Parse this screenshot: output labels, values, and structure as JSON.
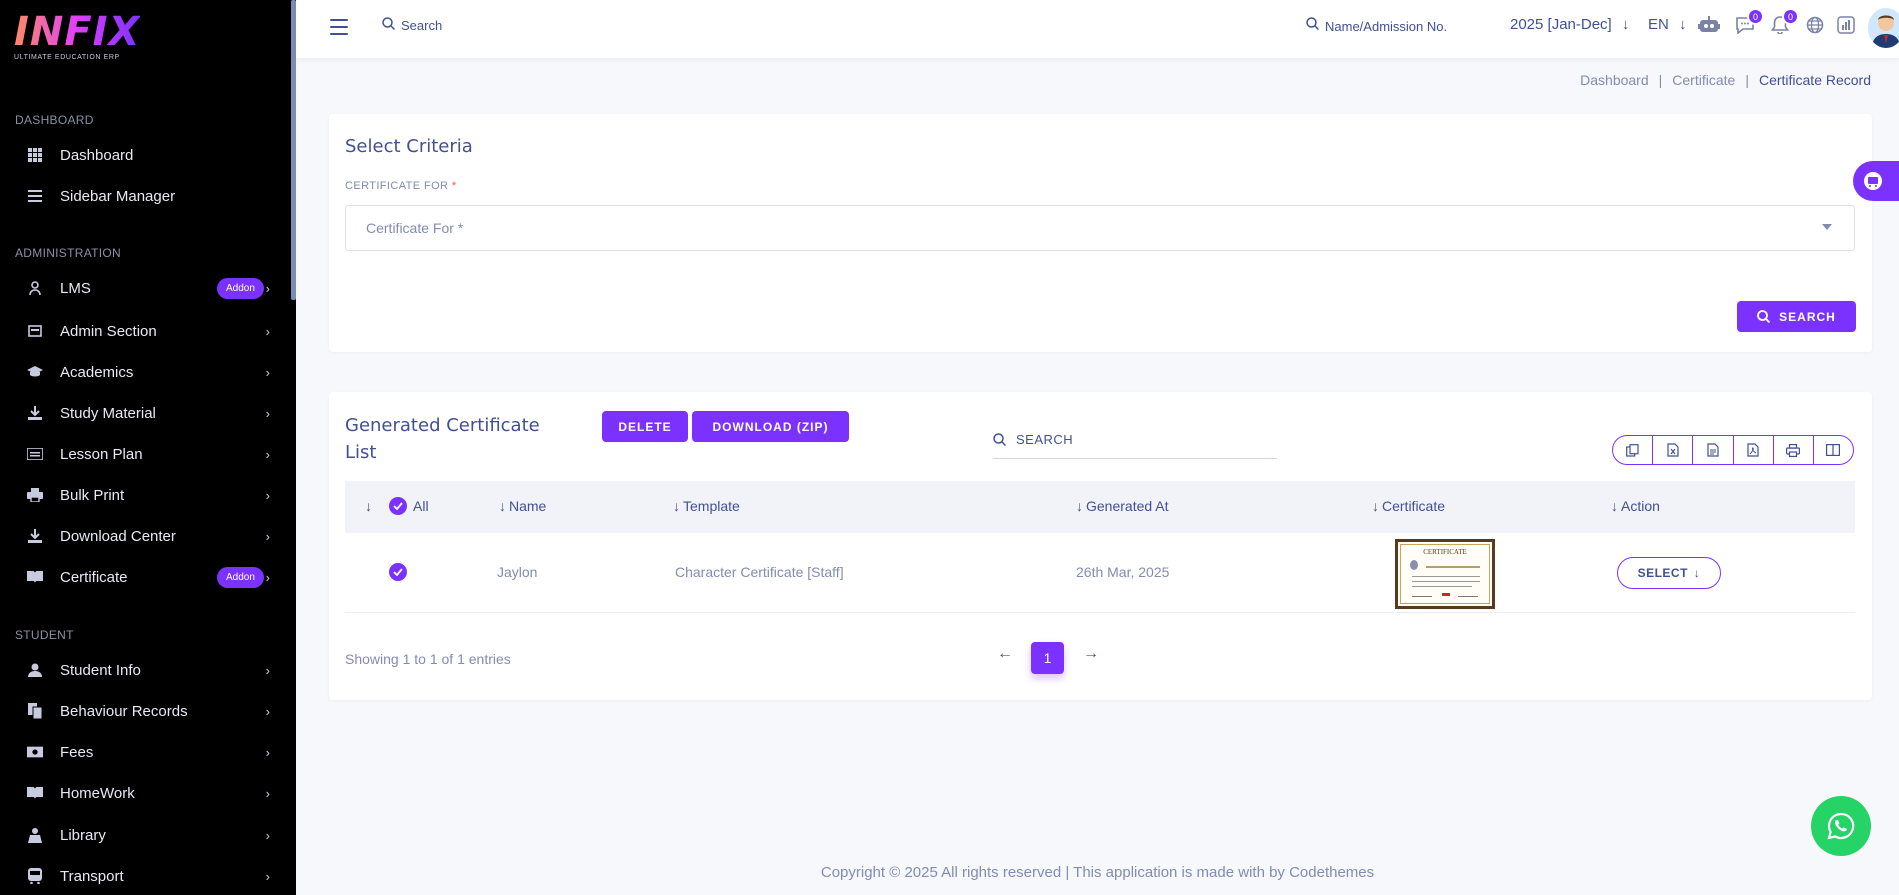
{
  "brand": {
    "logo": "INFIX",
    "tagline": "ULTIMATE EDUCATION ERP"
  },
  "sidebar": {
    "sections": [
      {
        "title": "DASHBOARD",
        "items": [
          {
            "label": "Dashboard",
            "icon": "grid-icon"
          },
          {
            "label": "Sidebar Manager",
            "icon": "list-icon"
          }
        ]
      },
      {
        "title": "ADMINISTRATION",
        "items": [
          {
            "label": "LMS",
            "icon": "user-badge-icon",
            "addon": "Addon"
          },
          {
            "label": "Admin Section",
            "icon": "admin-icon"
          },
          {
            "label": "Academics",
            "icon": "graduation-cap-icon"
          },
          {
            "label": "Study Material",
            "icon": "download-icon"
          },
          {
            "label": "Lesson Plan",
            "icon": "lesson-icon"
          },
          {
            "label": "Bulk Print",
            "icon": "print-icon"
          },
          {
            "label": "Download Center",
            "icon": "download-icon"
          },
          {
            "label": "Certificate",
            "icon": "book-icon",
            "addon": "Addon"
          }
        ]
      },
      {
        "title": "STUDENT",
        "items": [
          {
            "label": "Student Info",
            "icon": "student-icon"
          },
          {
            "label": "Behaviour Records",
            "icon": "records-icon"
          },
          {
            "label": "Fees",
            "icon": "money-icon"
          },
          {
            "label": "HomeWork",
            "icon": "book-icon"
          },
          {
            "label": "Library",
            "icon": "library-icon"
          },
          {
            "label": "Transport",
            "icon": "bus-icon"
          }
        ]
      }
    ]
  },
  "header": {
    "search_placeholder": "Search",
    "admission_placeholder": "Name/Admission No.",
    "year": "2025 [Jan-Dec]",
    "lang": "EN",
    "chat_count": "0",
    "notif_count": "0"
  },
  "breadcrumb": [
    "Dashboard",
    "Certificate",
    "Certificate Record"
  ],
  "criteria": {
    "title": "Select Criteria",
    "field_label": "CERTIFICATE FOR",
    "required_mark": "*",
    "select_placeholder": "Certificate For *",
    "search_button": "SEARCH"
  },
  "list": {
    "title_line1": "Generated Certificate",
    "title_line2": "List",
    "delete_button": "DELETE",
    "download_button": "DOWNLOAD (ZIP)",
    "search_placeholder": "SEARCH",
    "columns": {
      "all": "All",
      "name": "Name",
      "template": "Template",
      "generated_at": "Generated At",
      "certificate": "Certificate",
      "action": "Action"
    },
    "rows": [
      {
        "name": "Jaylon",
        "template": "Character Certificate [Staff]",
        "generated_at": "26th Mar, 2025",
        "action": "SELECT",
        "certificate_thumb_title": "CERTIFICATE"
      }
    ],
    "info": "Showing 1 to 1 of 1 entries",
    "current_page": "1"
  },
  "footer": "Copyright © 2025 All rights reserved | This application is made with by Codethemes",
  "colors": {
    "accent": "#7c32ff",
    "text": "#415094",
    "muted": "#828bb2",
    "whatsapp": "#25d366"
  }
}
